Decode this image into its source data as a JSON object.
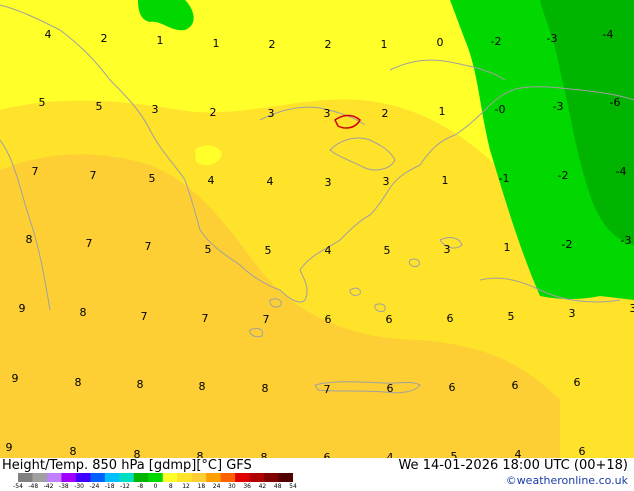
{
  "title": "Height/Temp. 850 hPa [gdmp][°C] GFS",
  "datetime": "We 14-01-2026 18:00 UTC (00+18)",
  "credit": "©weatheronline.co.uk",
  "colors": {
    "yellow": "#ffff2a",
    "yellow_orange": "#ffe22a",
    "orange": "#fdcf35",
    "light_green": "#00d800",
    "green": "#00b400",
    "coast": "#a0a0a0",
    "contour_red": "#d00000",
    "label": "#000000"
  },
  "colorbar": {
    "ticks": [
      "-54",
      "-48",
      "-42",
      "-38",
      "-30",
      "-24",
      "-18",
      "-12",
      "-8",
      "0",
      "8",
      "12",
      "18",
      "24",
      "30",
      "36",
      "42",
      "48",
      "54"
    ],
    "colors": [
      "#808080",
      "#a0a0a0",
      "#c080ff",
      "#a000ff",
      "#4000ff",
      "#0060ff",
      "#00c0ff",
      "#00e0c0",
      "#00b400",
      "#00d800",
      "#ffff2a",
      "#ffe22a",
      "#fdcf35",
      "#ffa000",
      "#ff6000",
      "#e00000",
      "#b00000",
      "#800000",
      "#500000"
    ]
  },
  "temp_labels": [
    "4",
    "2",
    "1",
    "1",
    "2",
    "2",
    "1",
    "0",
    "-2",
    "-3",
    "-4",
    "5",
    "5",
    "3",
    "2",
    "3",
    "3",
    "2",
    "1",
    "-0",
    "-3",
    "-6",
    "7",
    "7",
    "5",
    "4",
    "4",
    "3",
    "3",
    "1",
    "-1",
    "-2",
    "-4",
    "8",
    "7",
    "7",
    "5",
    "5",
    "4",
    "5",
    "3",
    "1",
    "-2",
    "-3",
    "9",
    "8",
    "7",
    "7",
    "7",
    "6",
    "6",
    "6",
    "5",
    "3",
    "3",
    "9",
    "8",
    "8",
    "8",
    "8",
    "7",
    "6",
    "6",
    "6",
    "6",
    "9",
    "8",
    "8",
    "8",
    "8",
    "6",
    "4",
    "5",
    "4",
    "6"
  ]
}
